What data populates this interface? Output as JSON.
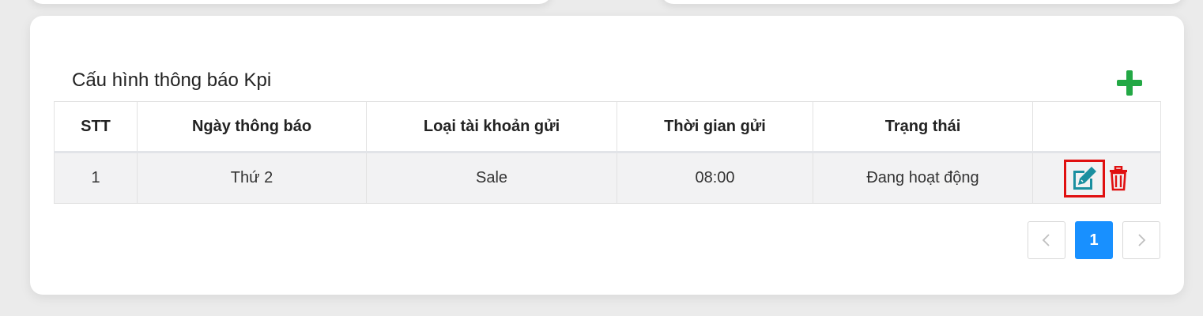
{
  "section": {
    "title": "Cấu hình thông báo Kpi"
  },
  "table": {
    "columns": [
      "STT",
      "Ngày thông báo",
      "Loại tài khoản gửi",
      "Thời gian gửi",
      "Trạng thái",
      ""
    ],
    "rows": [
      {
        "stt": "1",
        "ngay_thong_bao": "Thứ 2",
        "loai_tai_khoan": "Sale",
        "thoi_gian_gui": "08:00",
        "trang_thai": "Đang hoạt động"
      }
    ]
  },
  "pagination": {
    "current_page": "1"
  },
  "icons": {
    "add": "plus-icon",
    "edit": "edit-icon",
    "delete": "trash-icon",
    "prev": "chevron-left-icon",
    "next": "chevron-right-icon"
  },
  "colors": {
    "add": "#23a845",
    "edit": "#1a8fa0",
    "delete": "#e01010",
    "edit_highlight": "#e01010",
    "page_active": "#1890ff"
  }
}
